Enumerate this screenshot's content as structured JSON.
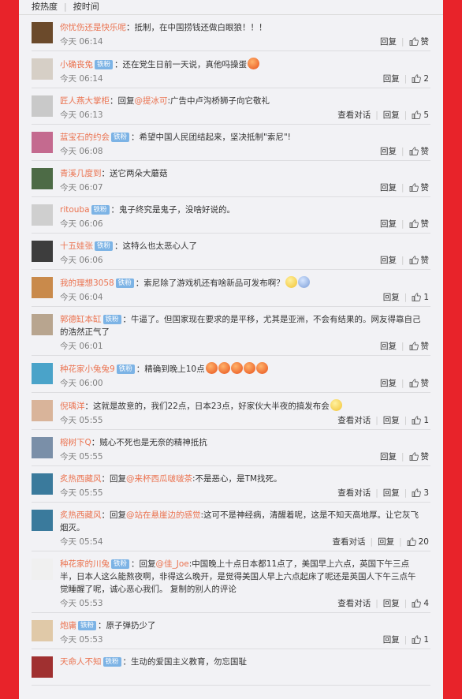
{
  "sort": {
    "hot": "按热度",
    "time": "按时间"
  },
  "labels": {
    "reply": "回复",
    "view": "查看对话",
    "praise": "赞",
    "badge": "铁粉"
  },
  "comments": [
    {
      "user": "你忧伤还是快乐呢",
      "badge": false,
      "text": "：抵制，在中国捞钱还做白眼狼！！！",
      "time": "今天 06:14",
      "likes": "",
      "view": false,
      "av": "#6b4a2b"
    },
    {
      "user": "小确丧兔",
      "badge": true,
      "text": "：还在党生日前一天说，真他吗操蛋",
      "time": "今天 06:14",
      "likes": "2",
      "view": false,
      "av": "#d6cfc6",
      "emoji": [
        "red"
      ]
    },
    {
      "user": "匠人燕大掌柜",
      "badge": false,
      "pre": "：回复",
      "mention": "@提冰可",
      "text": ":广告中卢沟桥狮子向它敬礼",
      "time": "今天 06:13",
      "likes": "5",
      "view": true,
      "av": "#c9c9c9"
    },
    {
      "user": "蓝宝石的约会",
      "badge": true,
      "text": "：希望中国人民团结起来，坚决抵制\"索尼\"!",
      "time": "今天 06:08",
      "likes": "",
      "view": false,
      "av": "#c46a8f"
    },
    {
      "user": "青溪几度到",
      "badge": false,
      "text": "：送它两朵大蘑菇",
      "time": "今天 06:07",
      "likes": "",
      "view": false,
      "av": "#4d6b46"
    },
    {
      "user": "ritouba",
      "badge": true,
      "text": "：鬼子终究是鬼子，没啥好说的。",
      "time": "今天 06:06",
      "likes": "",
      "view": false,
      "av": "#cfcfcf"
    },
    {
      "user": "十五娃张",
      "badge": true,
      "text": "：这特么也太恶心人了",
      "time": "今天 06:06",
      "likes": "",
      "view": false,
      "av": "#3d3d3d"
    },
    {
      "user": "我的理想3058",
      "badge": true,
      "text": "：索尼除了游戏机还有啥新品可发布啊？",
      "time": "今天 06:04",
      "likes": "1",
      "view": false,
      "av": "#c98a4b",
      "emoji": [
        "yel",
        "blu"
      ]
    },
    {
      "user": "郭德缸本缸",
      "badge": true,
      "text": "：牛逼了。但国家现在要求的是平移，尤其是亚洲，不会有结果的。网友得靠自己的浩然正气了",
      "time": "今天 06:01",
      "likes": "",
      "view": false,
      "av": "#b8a58f"
    },
    {
      "user": "种花家小兔兔9",
      "badge": true,
      "text": "：精确到晚上10点",
      "time": "今天 06:00",
      "likes": "",
      "view": false,
      "av": "#4aa3c9",
      "emoji": [
        "red",
        "red",
        "red",
        "red",
        "red"
      ]
    },
    {
      "user": "倪瑀洋",
      "badge": false,
      "text": "：这就是故意的，我们22点，日本23点，好家伙大半夜的搞发布会",
      "time": "今天 05:55",
      "likes": "1",
      "view": true,
      "av": "#d9b49a",
      "emoji": [
        "yel"
      ]
    },
    {
      "user": "榕树下Q",
      "badge": false,
      "text": "：贼心不死也是无奈的精神抵抗",
      "time": "今天 05:55",
      "likes": "",
      "view": false,
      "av": "#7a8fa8"
    },
    {
      "user": "炙热西藏风",
      "badge": false,
      "pre": "：回复",
      "mention": "@来杯西瓜啵啵茶",
      "text": ":不是恶心，是TM找死。",
      "time": "今天 05:55",
      "likes": "3",
      "view": true,
      "av": "#3a7a9c"
    },
    {
      "user": "炙热西藏风",
      "badge": false,
      "pre": "：回复",
      "mention": "@站在悬崖边的感觉",
      "text": ":这可不是神经病，清醒着呢，这是不知天高地厚。让它灰飞烟灭。",
      "time": "今天 05:54",
      "likes": "20",
      "view": true,
      "av": "#3a7a9c"
    },
    {
      "user": "种花家的川兔",
      "badge": true,
      "pre": "：回复",
      "mention": "@佳_Joe",
      "text": ":中国晚上十点日本都11点了，美国早上六点，英国下午三点半，日本人这么能熬夜啊，非得这么晚开，是觉得美国人早上六点起床了呢还是英国人下午三点午觉睡醒了呢，诚心恶心我们。 复制的别人的评论",
      "time": "今天 05:53",
      "likes": "4",
      "view": true,
      "av": "#f0f0f0"
    },
    {
      "user": "炮庸",
      "badge": true,
      "text": "：原子弹扔少了",
      "time": "今天 05:53",
      "likes": "1",
      "view": false,
      "av": "#e0c9a8"
    },
    {
      "user": "天命人不知",
      "badge": true,
      "text": "：生动的爱国主义教育，勿忘国耻",
      "time": "",
      "likes": "",
      "view": false,
      "av": "#a03030"
    }
  ]
}
